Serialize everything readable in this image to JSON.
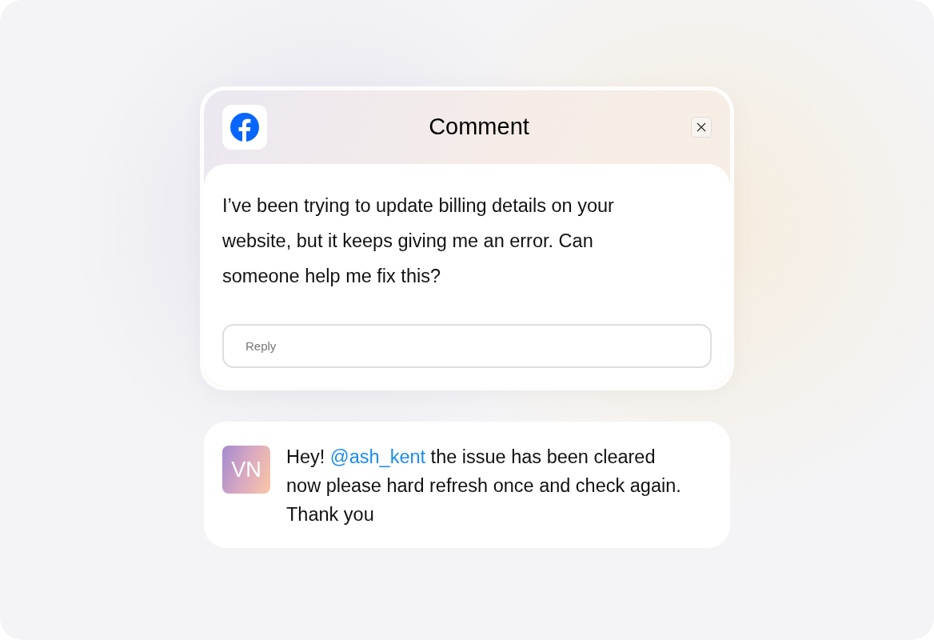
{
  "comment_dialog": {
    "title": "Comment",
    "message": "I’ve been trying to update billing details on your website, but it keeps giving me an error. Can someone help me fix this?",
    "reply_field": {
      "placeholder": "Reply"
    }
  },
  "reply": {
    "avatar_initials": "VN",
    "text_before": "Hey!",
    "mention": "@ash_kent",
    "text_after": "the issue has been cleared now please hard refresh once and check again. Thank you"
  }
}
